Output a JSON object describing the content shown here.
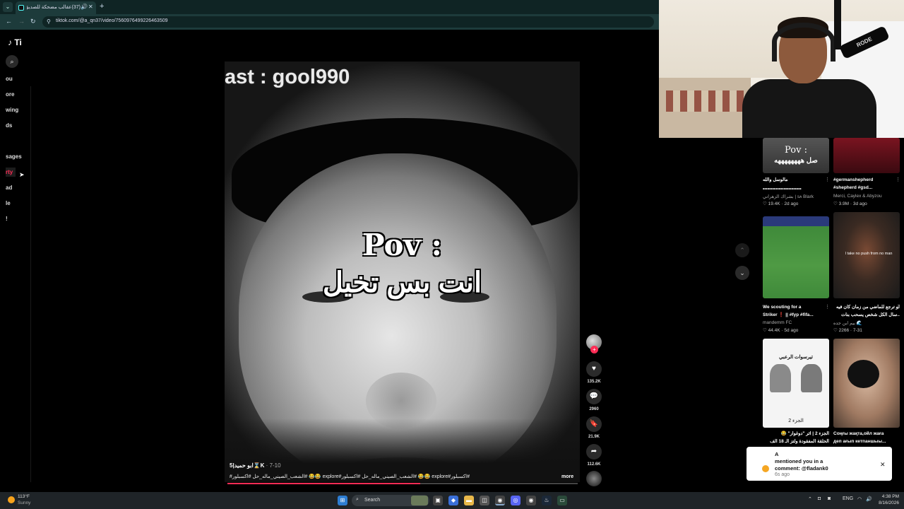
{
  "browser": {
    "tab_title": "(37)عقالب مضحكة للصديق",
    "url": "tiktok.com/@a_qn37/video/7560976499226463509"
  },
  "sidebar": {
    "logo": "Ti",
    "items": [
      {
        "label": "ou"
      },
      {
        "label": "ore"
      },
      {
        "label": "wing"
      },
      {
        "label": "ds"
      },
      {
        "label": "sages"
      },
      {
        "label": "rty"
      },
      {
        "label": "ad"
      },
      {
        "label": "le"
      },
      {
        "label": "!"
      }
    ]
  },
  "video": {
    "watermark": "ast : gool990",
    "overlay_line1": "Pov :",
    "overlay_line2": "انت بس تخيل",
    "author": "5|ابو حميد⌛K",
    "date": "7-10",
    "caption": "#اكسبلور#explore 😂😂 #الشعب_الصيني_ماله_حل #اكسبلور#explore 😂😂 #الشعب_الصيني_ماله_حل #اكسبلور#explore",
    "more_label": "more",
    "progress": 0.55
  },
  "actions": {
    "likes": "135.2K",
    "comments": "2960",
    "saves": "21.9K",
    "shares": "112.6K"
  },
  "related": [
    {
      "thumb_text": "Pov :",
      "thumb_sub": "صل ههههههههه",
      "title": "مالوسل والله",
      "title2": "••••••••••••••••••••••••",
      "author": "بشراك الزهراني | sᴀ Blark",
      "likes": "19.4K",
      "age": "2d ago"
    },
    {
      "thumb_text": "",
      "thumb_sub": "",
      "title": "#germanshepherd",
      "title2": "#shepherd #gsd...",
      "author": "Merci, Caylex & Abyzou",
      "likes": "3.9M",
      "age": "3d ago"
    },
    {
      "thumb_text": "",
      "thumb_sub": "",
      "title": "We scouting for a",
      "title2": "Striker ❗ || #fyp #fifa...",
      "author": "mandemm FC",
      "likes": "44.4K",
      "age": "5d ago"
    },
    {
      "thumb_text": "I take no push from no man",
      "thumb_sub": "",
      "title": "لو ترجع للماضي من زمان كان فيه",
      "title2": "..سال الكل شخص يسحب بنات",
      "author": "بيم ابن جده 🌊",
      "likes": "2266",
      "age": "7-31"
    },
    {
      "thumb_text": "تيرسوات الرعبي",
      "thumb_sub": "الجزء 2",
      "title": "الجزء 2 | اثر \"دوغوار\" 😂",
      "title2": "الحلقة المفقودة ولتز الـ 18 الف",
      "author": "",
      "likes": "",
      "age": ""
    },
    {
      "thumb_text": "",
      "thumb_sub": "",
      "title": "Соңғы жақта,ойл жаға",
      "title2": "деп ағып кетпаншыы...",
      "author": "",
      "likes": "",
      "age": ""
    }
  ],
  "webcam": {
    "mic_brand": "RODE"
  },
  "notification": {
    "line1": "A",
    "line2": "mentioned you in a",
    "line3": "comment: @fladank0",
    "time": "6s ago"
  },
  "taskbar": {
    "temp": "113°F",
    "condition": "Sunny",
    "search_label": "Search",
    "lang": "ENG",
    "time": "4:38 PM",
    "date": "8/16/2026"
  }
}
